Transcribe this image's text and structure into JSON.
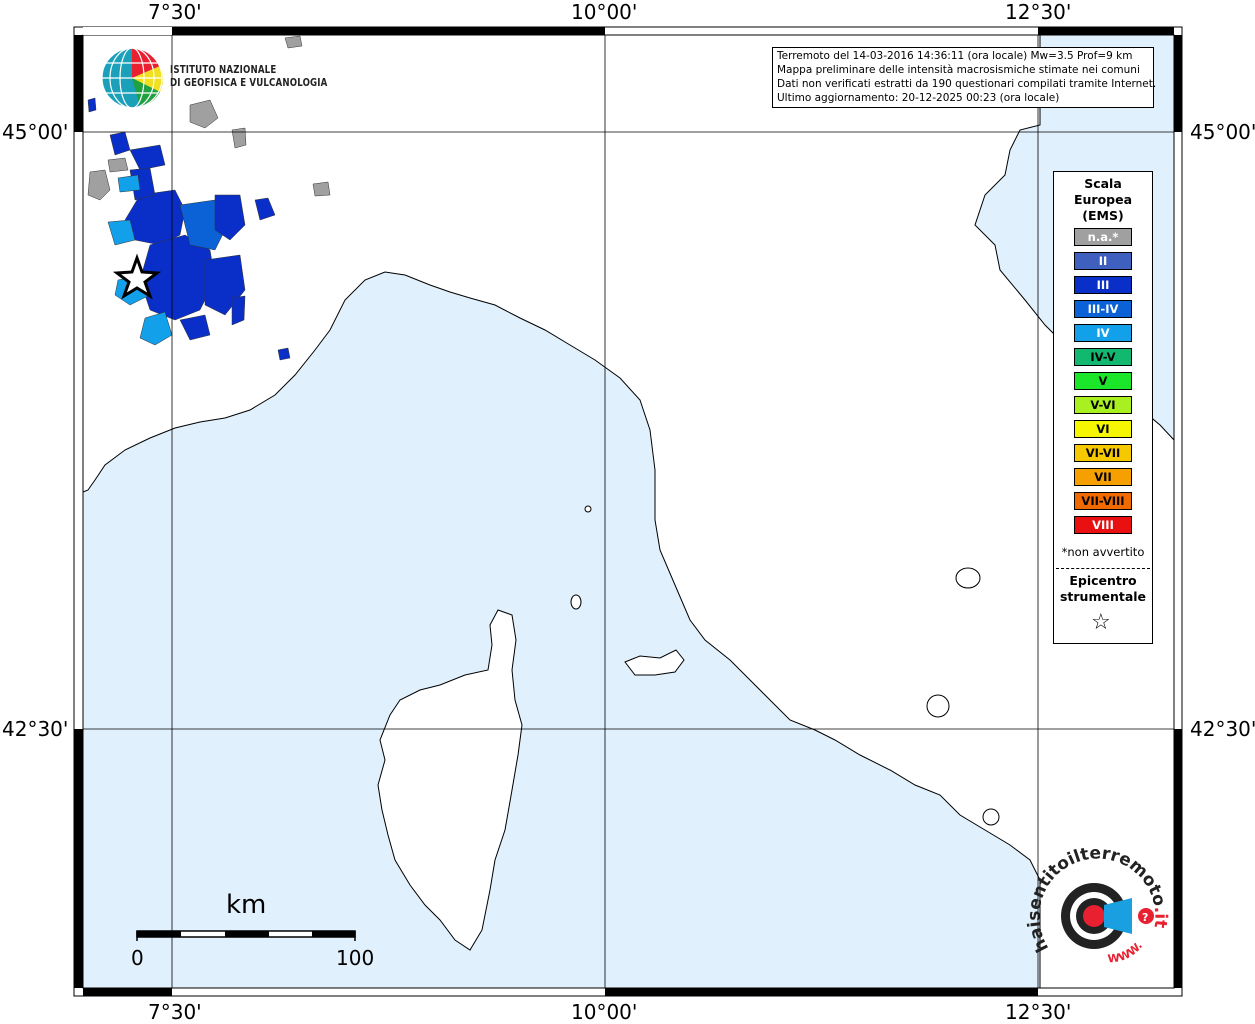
{
  "map": {
    "longitude_labels": [
      "7°30'",
      "10°00'",
      "12°30'"
    ],
    "latitude_labels": [
      "45°00'",
      "42°30'"
    ],
    "colors": {
      "sea": "#e0f0fc",
      "land": "#ffffff",
      "coast": "#000000",
      "grid": "#000000"
    }
  },
  "header": {
    "lines": [
      "Terremoto del 14-03-2016 14:36:11 (ora locale) Mw=3.5 Prof=9 km",
      "Mappa preliminare delle intensità macrosismiche stimate nei comuni",
      "Dati non verificati estratti da 190 questionari compilati tramite Internet.",
      "Ultimo aggiornamento: 20-12-2025 00:23 (ora locale)"
    ]
  },
  "logo": {
    "line1": "ISTITUTO NAZIONALE",
    "line2": "DI GEOFISICA E VULCANOLOGIA",
    "icon": "ingv-globe-icon"
  },
  "legend": {
    "title_lines": [
      "Scala",
      "Europea",
      "(EMS)"
    ],
    "items": [
      {
        "label": "n.a.*",
        "color": "#a0a0a0",
        "text_color": "#ffffff"
      },
      {
        "label": "II",
        "color": "#4060c0",
        "text_color": "#ffffff"
      },
      {
        "label": "III",
        "color": "#0a2fc8",
        "text_color": "#ffffff"
      },
      {
        "label": "III-IV",
        "color": "#0b62d6",
        "text_color": "#ffffff"
      },
      {
        "label": "IV",
        "color": "#12a0ea",
        "text_color": "#ffffff"
      },
      {
        "label": "IV-V",
        "color": "#13b870",
        "text_color": "#000000"
      },
      {
        "label": "V",
        "color": "#1ce62a",
        "text_color": "#000000"
      },
      {
        "label": "V-VI",
        "color": "#a8f020",
        "text_color": "#000000"
      },
      {
        "label": "VI",
        "color": "#f6f600",
        "text_color": "#000000"
      },
      {
        "label": "VI-VII",
        "color": "#f6c800",
        "text_color": "#000000"
      },
      {
        "label": "VII",
        "color": "#f6a000",
        "text_color": "#000000"
      },
      {
        "label": "VII-VIII",
        "color": "#f06a00",
        "text_color": "#000000"
      },
      {
        "label": "VIII",
        "color": "#e81010",
        "text_color": "#ffffff"
      }
    ],
    "note": "*non avvertito",
    "epicenter_lines": [
      "Epicentro",
      "strumentale"
    ],
    "epicenter_symbol": "star-icon"
  },
  "scale_bar": {
    "unit": "km",
    "start": "0",
    "end": "100"
  },
  "brand": {
    "text_main": "haisentitoilterremoto",
    "text_tld": ".it",
    "text_www": "WWW.",
    "icon": "hsit-target-icon"
  }
}
